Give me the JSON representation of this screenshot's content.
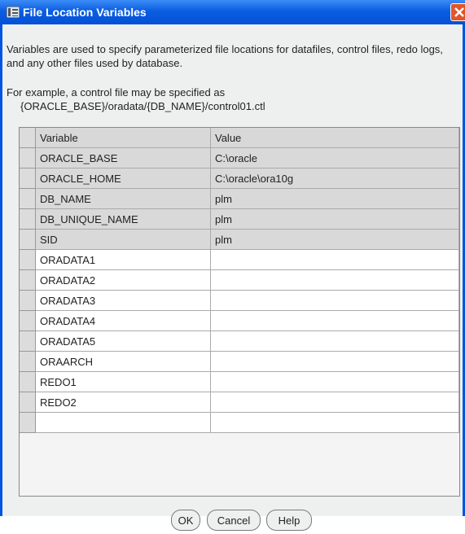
{
  "window": {
    "title": "File Location Variables"
  },
  "description": {
    "intro": "Variables are used to specify parameterized file locations for datafiles, control files, redo logs, and any other files used by database.",
    "example_line1": "For example, a control file may be specified as",
    "example_line2": "{ORACLE_BASE}/oradata/{DB_NAME}/control01.ctl"
  },
  "table": {
    "headers": [
      "Variable",
      "Value"
    ],
    "rows": [
      {
        "variable": "ORACLE_BASE",
        "value": "C:\\oracle",
        "editable": false
      },
      {
        "variable": "ORACLE_HOME",
        "value": "C:\\oracle\\ora10g",
        "editable": false
      },
      {
        "variable": "DB_NAME",
        "value": "plm",
        "editable": false
      },
      {
        "variable": "DB_UNIQUE_NAME",
        "value": "plm",
        "editable": false
      },
      {
        "variable": "SID",
        "value": "plm",
        "editable": false
      },
      {
        "variable": "ORADATA1",
        "value": "",
        "editable": true
      },
      {
        "variable": "ORADATA2",
        "value": "",
        "editable": true
      },
      {
        "variable": "ORADATA3",
        "value": "",
        "editable": true
      },
      {
        "variable": "ORADATA4",
        "value": "",
        "editable": true
      },
      {
        "variable": "ORADATA5",
        "value": "",
        "editable": true
      },
      {
        "variable": "ORAARCH",
        "value": "",
        "editable": true
      },
      {
        "variable": "REDO1",
        "value": "",
        "editable": true
      },
      {
        "variable": "REDO2",
        "value": "",
        "editable": true
      },
      {
        "variable": "",
        "value": "",
        "editable": true
      }
    ]
  },
  "buttons": {
    "ok": "OK",
    "cancel": "Cancel",
    "help": "Help"
  },
  "colors": {
    "titlebar": "#0a5ee0",
    "readonly_cell": "#d9d9d9",
    "editable_cell": "#ffffff",
    "dialog_bg": "#eef0f0"
  }
}
